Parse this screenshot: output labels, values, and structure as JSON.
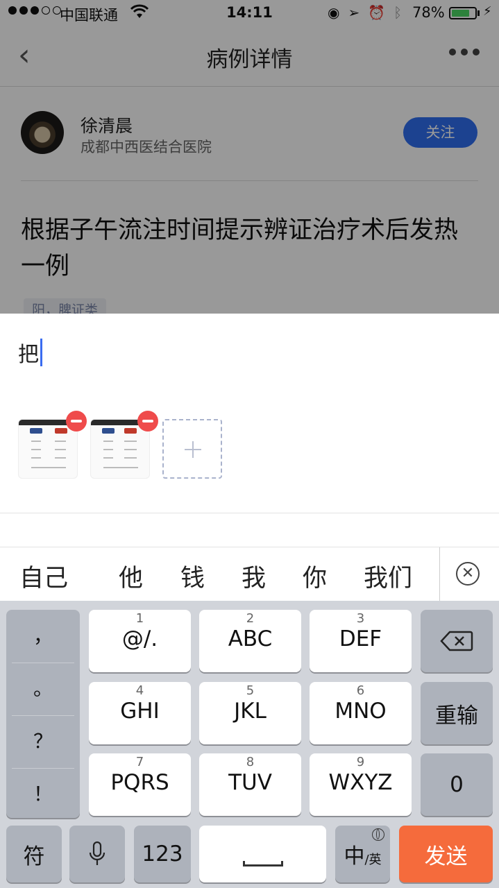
{
  "status_bar": {
    "carrier": "中国联通",
    "time": "14:11",
    "battery_percent": "78%",
    "battery_level": 0.78,
    "icons": [
      "signal-dots-icon",
      "wifi-icon",
      "orientation-lock-icon",
      "location-arrow-icon",
      "alarm-icon",
      "bluetooth-icon",
      "battery-icon",
      "charging-bolt-icon"
    ]
  },
  "nav": {
    "back_icon": "chevron-left-icon",
    "title": "病例详情",
    "more_icon": "more-dots-icon"
  },
  "author": {
    "name": "徐清晨",
    "hospital": "成都中西医结合医院",
    "follow_label": "关注"
  },
  "article": {
    "title": "根据子午流注时间提示辨证治疗术后发热一例",
    "tag": "阳，脾证类"
  },
  "composer": {
    "text": "把",
    "attachments": 2,
    "add_icon": "plus-icon",
    "remove_icon": "remove-minus-icon"
  },
  "candidates": {
    "items": [
      "自己",
      "他",
      "钱",
      "我",
      "你",
      "我们"
    ],
    "close_icon": "close-circle-icon"
  },
  "keyboard": {
    "punctuation": [
      "，",
      "。",
      "？",
      "！"
    ],
    "keys": [
      {
        "num": "1",
        "label": "@/."
      },
      {
        "num": "2",
        "label": "ABC"
      },
      {
        "num": "3",
        "label": "DEF"
      },
      {
        "num": "4",
        "label": "GHI"
      },
      {
        "num": "5",
        "label": "JKL"
      },
      {
        "num": "6",
        "label": "MNO"
      },
      {
        "num": "7",
        "label": "PQRS"
      },
      {
        "num": "8",
        "label": "TUV"
      },
      {
        "num": "9",
        "label": "WXYZ"
      }
    ],
    "delete_icon": "backspace-icon",
    "retype_label": "重输",
    "zero_label": "0",
    "symbol_label": "符",
    "mic_icon": "microphone-icon",
    "numbers_label": "123",
    "space_icon": "space-icon",
    "lang_main": "中",
    "lang_sub": "/英",
    "globe_icon": "globe-icon",
    "send_label": "发送"
  }
}
